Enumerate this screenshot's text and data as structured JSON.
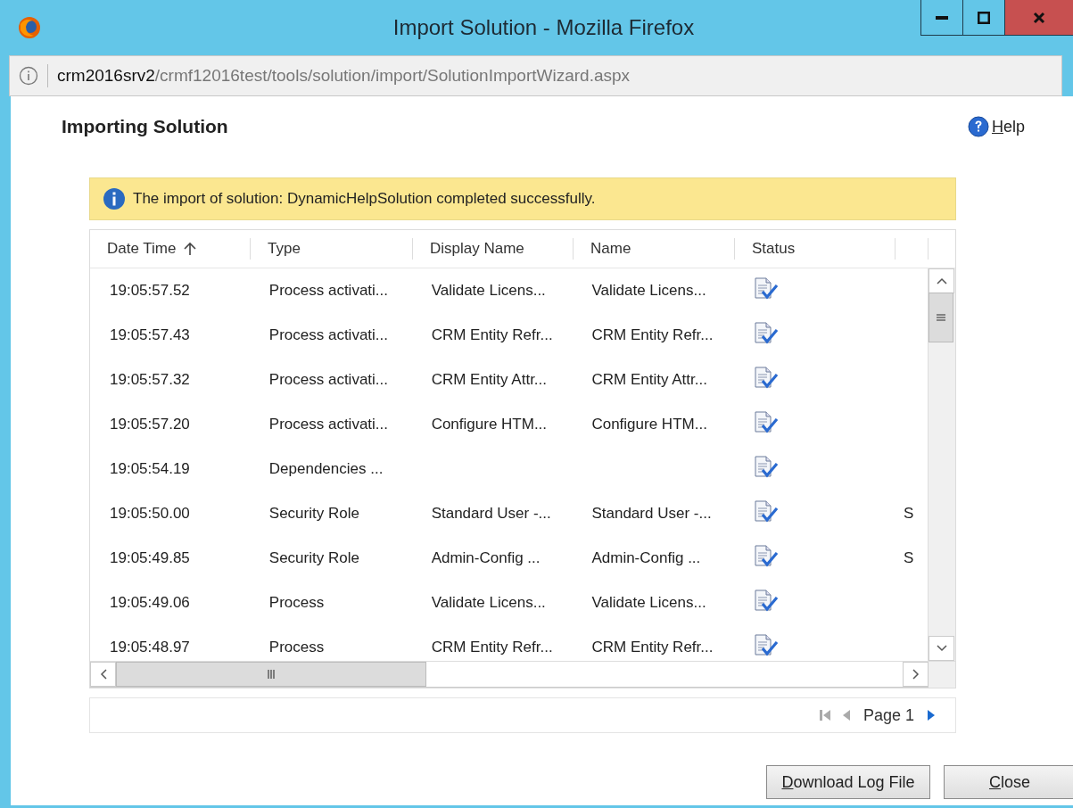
{
  "window": {
    "title": "Import Solution - Mozilla Firefox"
  },
  "address_bar": {
    "host": "crm2016srv2",
    "path": "/crmf12016test/tools/solution/import/SolutionImportWizard.aspx"
  },
  "page": {
    "heading": "Importing Solution",
    "help": {
      "label": "Help"
    }
  },
  "notification": {
    "message": "The import of solution: DynamicHelpSolution completed successfully."
  },
  "table": {
    "columns": [
      {
        "label": "Date Time",
        "sorted": true
      },
      {
        "label": "Type",
        "sorted": false
      },
      {
        "label": "Display Name",
        "sorted": false
      },
      {
        "label": "Name",
        "sorted": false
      },
      {
        "label": "Status",
        "sorted": false
      },
      {
        "sorted": false
      }
    ],
    "rows": [
      {
        "date_time": "19:05:57.52",
        "type": "Process activati...",
        "display_name": "Validate Licens...",
        "name": "Validate Licens...",
        "completed": true
      },
      {
        "date_time": "19:05:57.43",
        "type": "Process activati...",
        "display_name": "CRM Entity Refr...",
        "name": "CRM Entity Refr...",
        "completed": true
      },
      {
        "date_time": "19:05:57.32",
        "type": "Process activati...",
        "display_name": "CRM Entity Attr...",
        "name": "CRM Entity Attr...",
        "completed": true
      },
      {
        "date_time": "19:05:57.20",
        "type": "Process activati...",
        "display_name": "Configure HTM...",
        "name": "Configure HTM...",
        "completed": true
      },
      {
        "date_time": "19:05:54.19",
        "type": "Dependencies ...",
        "completed": true
      },
      {
        "date_time": "19:05:50.00",
        "type": "Security Role",
        "display_name": "Standard User -...",
        "name": "Standard User -...",
        "completed": true,
        "column_6": "S"
      },
      {
        "date_time": "19:05:49.85",
        "type": "Security Role",
        "display_name": "Admin-Config ...",
        "name": "Admin-Config ...",
        "completed": true,
        "column_6": "S"
      },
      {
        "date_time": "19:05:49.06",
        "type": "Process",
        "display_name": "Validate Licens...",
        "name": "Validate Licens...",
        "completed": true
      },
      {
        "date_time": "19:05:48.97",
        "type": "Process",
        "display_name": "CRM Entity Refr...",
        "name": "CRM Entity Refr...",
        "completed": true
      }
    ]
  },
  "pager": {
    "label": "Page 1",
    "first_disabled": true,
    "previous_disabled": true,
    "next_disabled": false
  },
  "buttons": [
    {
      "label": "Download Log File"
    },
    {
      "label": "Close"
    }
  ]
}
